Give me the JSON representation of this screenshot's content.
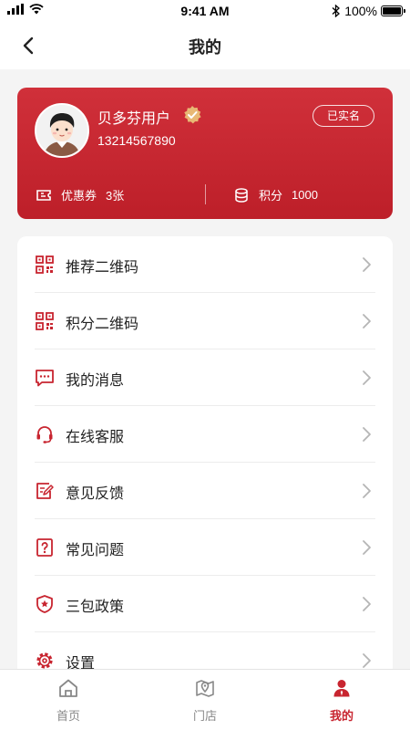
{
  "status_bar": {
    "time": "9:41 AM",
    "battery": "100%"
  },
  "nav": {
    "title": "我的"
  },
  "profile": {
    "name": "贝多芬用户",
    "phone": "13214567890",
    "verified_badge": "已实名",
    "coupon_label": "优惠券",
    "coupon_value": "3张",
    "points_label": "积分",
    "points_value": "1000"
  },
  "menu": {
    "items": [
      {
        "label": "推荐二维码",
        "icon": "qr-code-icon"
      },
      {
        "label": "积分二维码",
        "icon": "qr-code-icon"
      },
      {
        "label": "我的消息",
        "icon": "message-icon"
      },
      {
        "label": "在线客服",
        "icon": "headset-icon"
      },
      {
        "label": "意见反馈",
        "icon": "feedback-icon"
      },
      {
        "label": "常见问题",
        "icon": "question-icon"
      },
      {
        "label": "三包政策",
        "icon": "shield-star-icon"
      },
      {
        "label": "设置",
        "icon": "gear-icon"
      }
    ]
  },
  "tabs": [
    {
      "label": "首页",
      "icon": "home-icon"
    },
    {
      "label": "门店",
      "icon": "map-pin-icon"
    },
    {
      "label": "我的",
      "icon": "user-icon",
      "active": true
    }
  ],
  "colors": {
    "brand": "#c82530",
    "card_top": "#d0303a",
    "card_bottom": "#bd1f29"
  }
}
